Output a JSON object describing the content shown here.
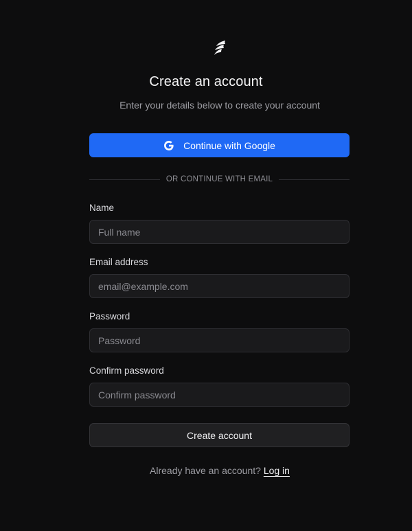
{
  "header": {
    "logo_icon": "flame-logo-icon",
    "title": "Create an account",
    "subtitle": "Enter your details below to create your account"
  },
  "google": {
    "icon": "google-g-icon",
    "label": "Continue with Google",
    "color": "#1f69f5"
  },
  "divider": {
    "text": "OR CONTINUE WITH EMAIL"
  },
  "form": {
    "name": {
      "label": "Name",
      "placeholder": "Full name",
      "value": ""
    },
    "email": {
      "label": "Email address",
      "placeholder": "email@example.com",
      "value": ""
    },
    "password": {
      "label": "Password",
      "placeholder": "Password",
      "value": ""
    },
    "confirm_password": {
      "label": "Confirm password",
      "placeholder": "Confirm password",
      "value": ""
    },
    "submit_label": "Create account"
  },
  "footer": {
    "prompt": "Already have an account?",
    "link_label": "Log in"
  },
  "colors": {
    "background": "#0d0d0e",
    "accent": "#1f69f5",
    "input_bg": "#1a1a1c"
  }
}
